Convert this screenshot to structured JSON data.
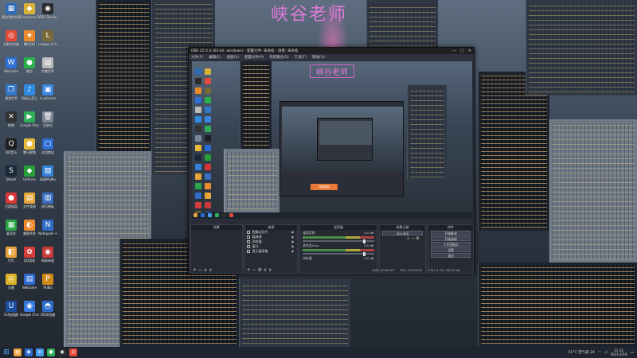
{
  "wallpaper": {
    "title": "峡谷老师"
  },
  "desktop_icons": [
    {
      "label": "漫游我的世界",
      "color": "#2e6ab5",
      "glyph": "▦"
    },
    {
      "label": "Geometry Dash",
      "color": "#d9b23a",
      "glyph": "◆"
    },
    {
      "label": "OBS Studio",
      "color": "#2b2b2b",
      "glyph": "◉"
    },
    {
      "label": "谷歌浏览器",
      "color": "#e24a3a",
      "glyph": "◎"
    },
    {
      "label": "腾讯QQ",
      "color": "#ec8a2b",
      "glyph": "★"
    },
    {
      "label": "League of Legends",
      "color": "#7a6a3a",
      "glyph": "L"
    },
    {
      "label": "WeGame",
      "color": "#2d6fd6",
      "glyph": "W"
    },
    {
      "label": "微信",
      "color": "#28b04a",
      "glyph": "●"
    },
    {
      "label": "完美世界",
      "color": "#bbbbbb",
      "glyph": "▤"
    },
    {
      "label": "漫游世界",
      "color": "#3578c8",
      "glyph": "❐"
    },
    {
      "label": "网易云音乐",
      "color": "#2f8be0",
      "glyph": "♪"
    },
    {
      "label": "vivoGame",
      "color": "#3d86e0",
      "glyph": "▣"
    },
    {
      "label": "剪映",
      "color": "#333333",
      "glyph": "✕"
    },
    {
      "label": "Google Play",
      "color": "#2fae5a",
      "glyph": "▶"
    },
    {
      "label": "回收站",
      "color": "#7c8898",
      "glyph": "🗑"
    },
    {
      "label": "QQ音乐",
      "color": "#1f1f1f",
      "glyph": "Q"
    },
    {
      "label": "腾讯视频",
      "color": "#e8b93a",
      "glyph": "●"
    },
    {
      "label": "应用商店",
      "color": "#2c6cd2",
      "glyph": "▢"
    },
    {
      "label": "Steam",
      "color": "#1b2838",
      "glyph": "S"
    },
    {
      "label": "Geforce",
      "color": "#2a9e3a",
      "glyph": "◆"
    },
    {
      "label": "网易MuMu",
      "color": "#3384d8",
      "glyph": "▨"
    },
    {
      "label": "百度网盘",
      "color": "#d63636",
      "glyph": "●"
    },
    {
      "label": "文件管理",
      "color": "#e8a63a",
      "glyph": "▤"
    },
    {
      "label": "网页模板",
      "color": "#3a6fc4",
      "glyph": "▥"
    },
    {
      "label": "爱奇艺",
      "color": "#2aa54a",
      "glyph": "▦"
    },
    {
      "label": "美图秀秀",
      "color": "#f08a2e",
      "glyph": "◐"
    },
    {
      "label": "Notepad++",
      "color": "#2f6dc8",
      "glyph": "N"
    },
    {
      "label": "钉钉",
      "color": "#e8a23a",
      "glyph": "◧"
    },
    {
      "label": "QQ游戏",
      "color": "#d43c3c",
      "glyph": "✿"
    },
    {
      "label": "网易有道",
      "color": "#c83a3a",
      "glyph": "◉"
    },
    {
      "label": "迅雷",
      "color": "#d9b226",
      "glyph": "◎"
    },
    {
      "label": "WeGame",
      "color": "#2e6ad0",
      "glyph": "▤"
    },
    {
      "label": "PUBG",
      "color": "#d08a1a",
      "glyph": "P"
    },
    {
      "label": "UU加速器",
      "color": "#1d4ea0",
      "glyph": "U"
    },
    {
      "label": "Google Chrome",
      "color": "#3579e0",
      "glyph": "◉"
    },
    {
      "label": "QQ浏览器",
      "color": "#2f6ecf",
      "glyph": "◓"
    }
  ],
  "obs": {
    "title": "OBS 25.0.4 (64-bit, windows) - 配置文件: 未命名 - 场景: 未命名",
    "menu": [
      "文件(F)",
      "编辑(E)",
      "视图(V)",
      "配置文件(P)",
      "场景集合(S)",
      "工具(T)",
      "帮助(H)"
    ],
    "preview_title": "峡谷老师",
    "nested_button": "开始录制",
    "docks": {
      "scenes": {
        "title": "场景",
        "footer": "+ − ∧ ∨"
      },
      "sources": {
        "title": "来源",
        "items": [
          "图像幻灯片",
          "媒体源",
          "浏览器",
          "窗口",
          "显示器采集"
        ],
        "footer": "+ − ⚙ ∧ ∨"
      },
      "mixer": {
        "title": "混音器",
        "tracks": [
          {
            "name": "桌面音频",
            "db": "0.0 dB"
          },
          {
            "name": "麦克风/Aux",
            "db": "0.0 dB"
          },
          {
            "name": "浏览器",
            "db": "0.0 dB"
          }
        ]
      },
      "transitions": {
        "title": "场景过渡",
        "value": "淡入淡出",
        "footer": "+ − ⚙"
      },
      "controls": {
        "title": "控件",
        "buttons": [
          "开始推流",
          "开始录制",
          "工作室模式",
          "设置",
          "退出"
        ]
      }
    },
    "status": [
      "LIVE: 00:00:00",
      "REC: 00:00:00",
      "CPU: 1.3%, 60.00 fps"
    ]
  },
  "taskbar": {
    "apps": [
      {
        "color": "#e8a23a",
        "glyph": "▤"
      },
      {
        "color": "#2e6ad0",
        "glyph": "◉"
      },
      {
        "color": "#4a9ef0",
        "glyph": "e"
      },
      {
        "color": "#2fae5a",
        "glyph": "●"
      },
      {
        "color": "#2b2b2b",
        "glyph": "◉"
      },
      {
        "color": "#e24a3a",
        "glyph": "◎"
      }
    ],
    "weather": "31°C 空气良 24",
    "time": "11:32",
    "date": "2021/2/19"
  }
}
